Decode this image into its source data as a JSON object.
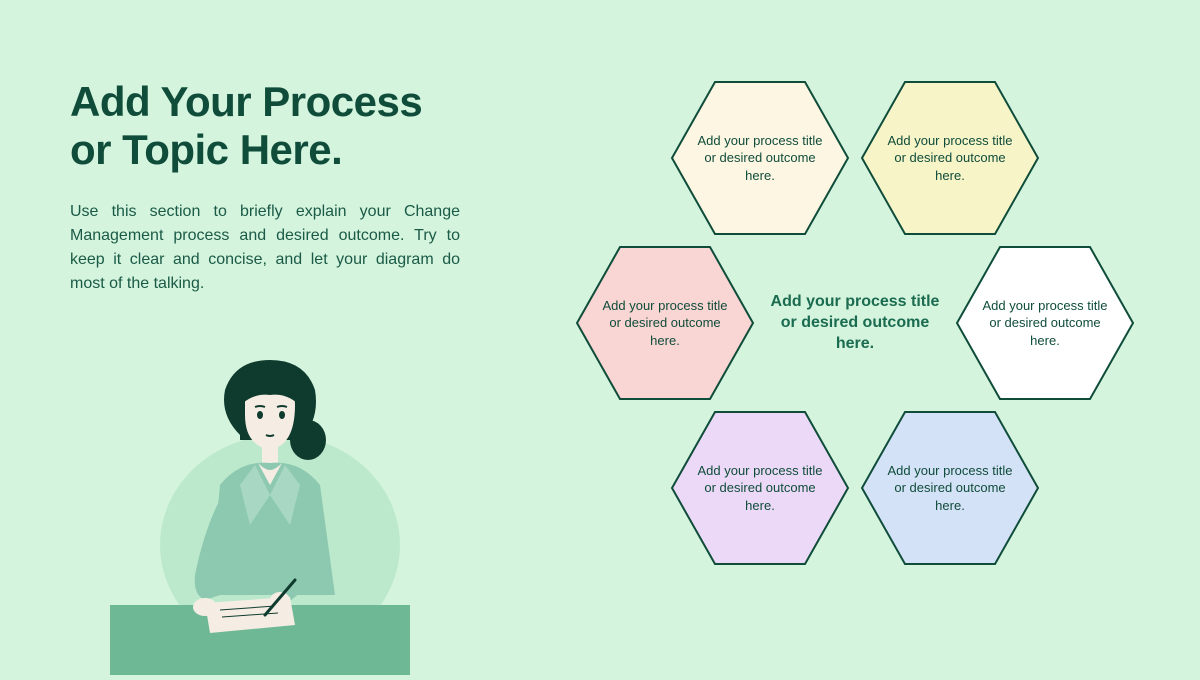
{
  "title_line1": "Add Your Process",
  "title_line2": "or Topic Here.",
  "description": "Use this section to briefly explain your Change Management process and desired outcome. Try to keep it clear and concise, and let your diagram do most of the talking.",
  "center_label": "Add your process title or desired outcome here.",
  "hexagons": [
    {
      "label": "Add your process title or desired outcome here.",
      "fill": "#fdf6e3",
      "stroke": "#0f4c3a"
    },
    {
      "label": "Add your process title or desired outcome here.",
      "fill": "#f7f5c8",
      "stroke": "#0f4c3a"
    },
    {
      "label": "Add your process title or desired outcome here.",
      "fill": "#f9d5d3",
      "stroke": "#0f4c3a"
    },
    {
      "label": "Add your process title or desired outcome here.",
      "fill": "#ffffff",
      "stroke": "#0f4c3a"
    },
    {
      "label": "Add your process title or desired outcome here.",
      "fill": "#ecd9f7",
      "stroke": "#0f4c3a"
    },
    {
      "label": "Add your process title or desired outcome here.",
      "fill": "#d4e2f7",
      "stroke": "#0f4c3a"
    }
  ],
  "colors": {
    "background": "#d4f4de",
    "heading": "#0f4c3a",
    "body": "#1a5a46"
  }
}
